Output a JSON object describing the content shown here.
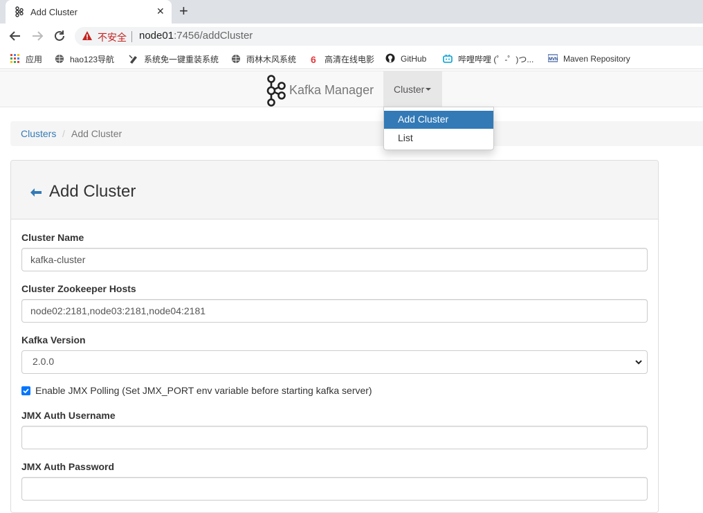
{
  "browser": {
    "tab_title": "Add Cluster",
    "tab_close": "✕",
    "new_tab": "+",
    "security_label": "不安全",
    "url_host": "node01",
    "url_rest": ":7456/addCluster",
    "bookmarks": [
      {
        "label": "应用",
        "icon": "apps-grid-icon"
      },
      {
        "label": "hao123导航",
        "icon": "globe-icon"
      },
      {
        "label": "系统免一键重装系统",
        "icon": "tool-icon"
      },
      {
        "label": "雨林木风系统",
        "icon": "globe-icon"
      },
      {
        "label": "高清在线电影",
        "icon": "six-icon"
      },
      {
        "label": "GitHub",
        "icon": "github-icon"
      },
      {
        "label": "哔哩哔哩 (゜-゜)つ...",
        "icon": "bilibili-icon"
      },
      {
        "label": "Maven Repository",
        "icon": "maven-icon"
      }
    ]
  },
  "app": {
    "brand": "Kafka Manager",
    "nav_cluster": "Cluster",
    "dropdown": [
      "Add Cluster",
      "List"
    ],
    "breadcrumb": {
      "root": "Clusters",
      "sep": "/",
      "current": "Add Cluster"
    },
    "panel_title": "Add Cluster",
    "form": {
      "cluster_name_label": "Cluster Name",
      "cluster_name_value": "kafka-cluster",
      "zk_label": "Cluster Zookeeper Hosts",
      "zk_value": "node02:2181,node03:2181,node04:2181",
      "version_label": "Kafka Version",
      "version_value": "2.0.0",
      "jmx_checkbox_label": "Enable JMX Polling (Set JMX_PORT env variable before starting kafka server)",
      "jmx_checked": true,
      "jmx_user_label": "JMX Auth Username",
      "jmx_user_value": "",
      "jmx_pass_label": "JMX Auth Password",
      "jmx_pass_value": ""
    }
  },
  "colors": {
    "link": "#337ab7",
    "active_bg": "#337ab7",
    "warn": "#c5221f",
    "checkbox": "#0075ff"
  }
}
